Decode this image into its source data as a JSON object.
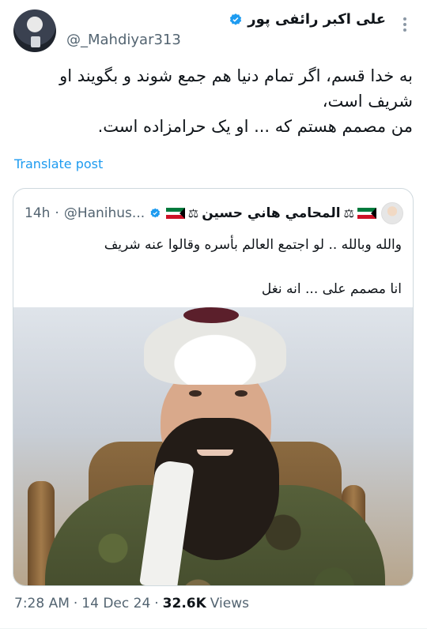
{
  "tweet": {
    "author_name": "علی اکبر رائفی پور",
    "handle": "@_Mahdiyar313",
    "body_lines": [
      "به خدا قسم، اگر تمام دنیا هم جمع شوند و بگویند او",
      "شریف است،",
      "من مصمم هستم که ... او یک حرامزاده است."
    ],
    "translate_label": "Translate post"
  },
  "quote": {
    "author_name": "المحامي هاني حسين",
    "handle": "@Hanihus...",
    "time": "14h",
    "line1": "والله وبالله .. لو اجتمع العالم بأسره وقالوا عنه شريف",
    "line2": "انا مصمم على ... انه نغل"
  },
  "meta": {
    "time": "7:28 AM",
    "date": "14 Dec 24",
    "views_count": "32.6K",
    "views_label": "Views"
  },
  "colors": {
    "link": "#1d9bf0",
    "verified": "#1d9bf0",
    "secondary_text": "#536471",
    "border": "#cfd9de"
  }
}
